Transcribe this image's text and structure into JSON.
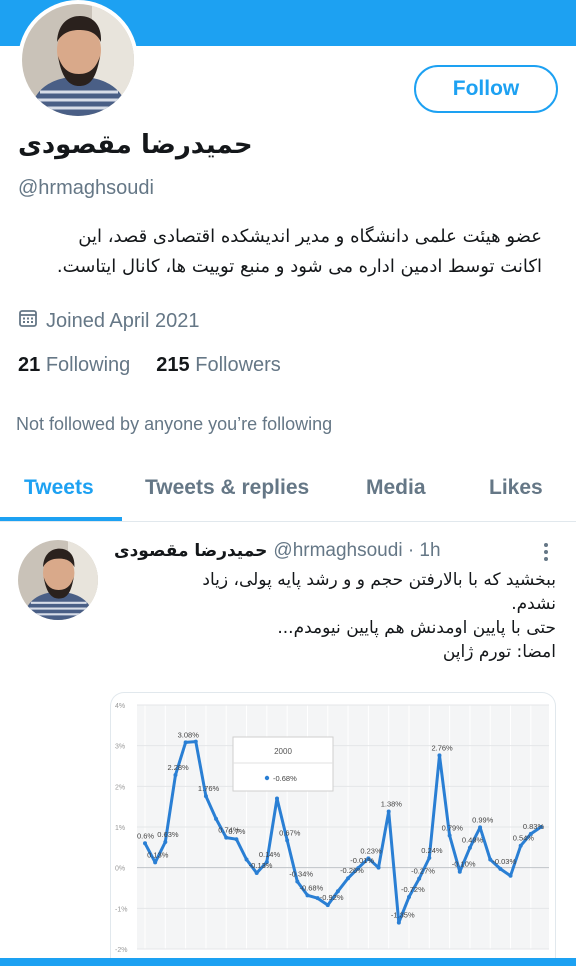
{
  "profile": {
    "name": "حمیدرضا مقصودی",
    "handle": "@hrmaghsoudi",
    "bio_lines": [
      "عضو هیئت علمی دانشگاه و مدیر اندیشکده اقتصادی قصد، این",
      "اکانت توسط ادمین اداره می شود و منبع توییت ها، کانال ایتاست."
    ],
    "joined": "Joined April 2021",
    "following_count": "21",
    "following_label": "Following",
    "followers_count": "215",
    "followers_label": "Followers",
    "not_followed": "Not followed by anyone you’re following",
    "follow_label": "Follow"
  },
  "tabs": [
    {
      "label": "Tweets",
      "active": true
    },
    {
      "label": "Tweets & replies",
      "active": false
    },
    {
      "label": "Media",
      "active": false
    },
    {
      "label": "Likes",
      "active": false
    }
  ],
  "tweet": {
    "name": "حمیدرضا مقصودی",
    "handle_time": "@hrmaghsoudi · 1h",
    "lines": [
      "ببخشید که با بالارفتن حجم و و رشد پایه پولی، زیاد",
      "نشدم.",
      "حتی با پایین اومدنش هم پایین نیومدم...",
      "امضا: تورم ژاپن"
    ]
  },
  "chart_data": {
    "type": "line",
    "ylim": [
      -2,
      4
    ],
    "yticks": [
      "4%",
      "3%",
      "2%",
      "1%",
      "0%",
      "-1%",
      "-2%"
    ],
    "legend": {
      "title": "2000",
      "entry": "-0.68%"
    },
    "values": [
      0.6,
      0.13,
      0.63,
      2.28,
      3.08,
      3.1,
      1.76,
      1.2,
      0.74,
      0.7,
      0.2,
      -0.13,
      0.14,
      1.7,
      0.67,
      -0.34,
      -0.68,
      -0.75,
      -0.92,
      -0.58,
      -0.26,
      -0.01,
      0.23,
      0.0,
      1.38,
      -1.35,
      -0.72,
      -0.27,
      0.24,
      2.76,
      0.79,
      -0.1,
      0.49,
      0.99,
      0.2,
      -0.03,
      -0.2,
      0.54,
      0.83,
      1.0
    ],
    "labels": [
      {
        "i": 0,
        "text": "0.6%"
      },
      {
        "i": 1,
        "text": "0.13%"
      },
      {
        "i": 2,
        "text": "0.63%"
      },
      {
        "i": 3,
        "text": "2.28%"
      },
      {
        "i": 4,
        "text": "3.08%"
      },
      {
        "i": 6,
        "text": "1.76%"
      },
      {
        "i": 8,
        "text": "0.74%"
      },
      {
        "i": 9,
        "text": "0.7%"
      },
      {
        "i": 11,
        "text": "-0.13%"
      },
      {
        "i": 12,
        "text": "0.14%"
      },
      {
        "i": 14,
        "text": "0.67%"
      },
      {
        "i": 15,
        "text": "-0.34%"
      },
      {
        "i": 16,
        "text": "-0.68%"
      },
      {
        "i": 18,
        "text": "-0.92%"
      },
      {
        "i": 20,
        "text": "-0.26%"
      },
      {
        "i": 21,
        "text": "-0.01%"
      },
      {
        "i": 22,
        "text": "0.23%"
      },
      {
        "i": 24,
        "text": "1.38%"
      },
      {
        "i": 25,
        "text": "-1.35%"
      },
      {
        "i": 26,
        "text": "-0.72%"
      },
      {
        "i": 27,
        "text": "-0.27%"
      },
      {
        "i": 28,
        "text": "0.24%"
      },
      {
        "i": 29,
        "text": "2.76%"
      },
      {
        "i": 30,
        "text": "0.79%"
      },
      {
        "i": 31,
        "text": "-0.10%"
      },
      {
        "i": 32,
        "text": "0.49%"
      },
      {
        "i": 33,
        "text": "0.99%"
      },
      {
        "i": 35,
        "text": "-0.03%"
      },
      {
        "i": 37,
        "text": "0.54%"
      },
      {
        "i": 38,
        "text": "0.83%"
      }
    ],
    "grid": true,
    "series_color": "#2a7fd4"
  },
  "colors": {
    "accent": "#1da1f2",
    "muted": "#657786",
    "text": "#14171a"
  }
}
